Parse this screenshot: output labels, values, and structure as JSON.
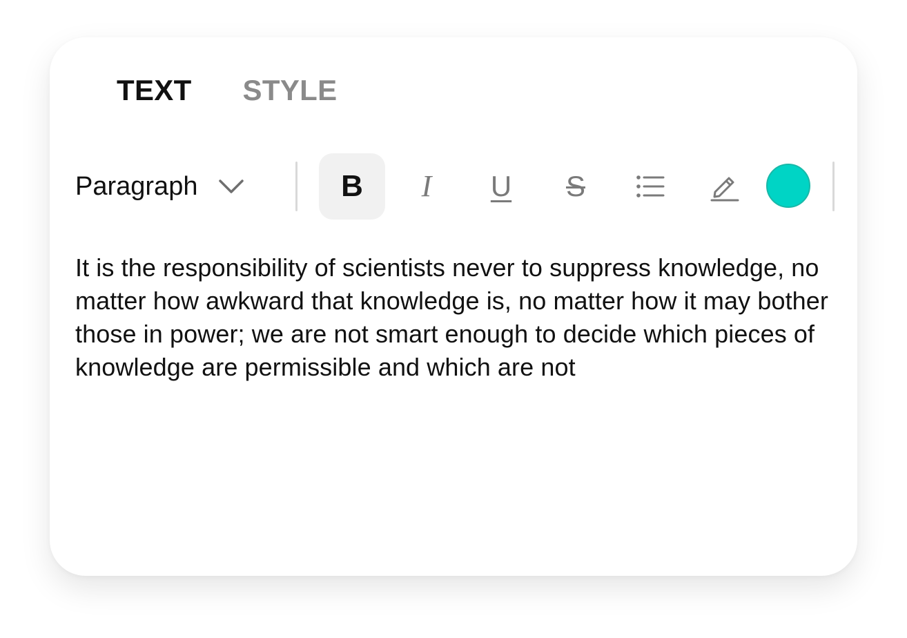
{
  "tabs": [
    {
      "label": "TEXT",
      "active": true
    },
    {
      "label": "STYLE",
      "active": false
    }
  ],
  "toolbar": {
    "block_type": "Paragraph",
    "bold_label": "B",
    "italic_label": "I",
    "underline_label": "U",
    "strike_label": "S",
    "bold_active": true,
    "list_icon": "bulleted-list-icon",
    "highlight_icon": "pencil-highlight-icon",
    "text_color": "#00d4c5"
  },
  "editor": {
    "content": "It is the responsibility of scientists never to suppress knowledge, no matter how awkward that knowledge is, no matter how it may bother those in power; we are not smart enough to decide which pieces of knowledge are permissible and which are not"
  }
}
